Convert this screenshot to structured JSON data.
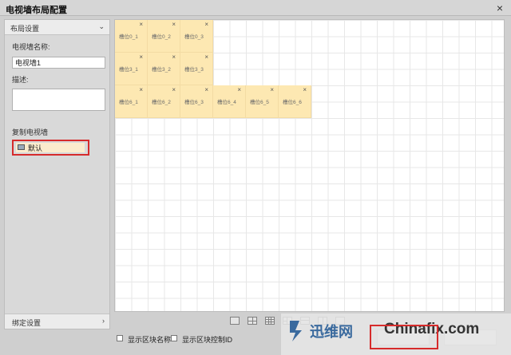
{
  "window": {
    "title": "电视墙布局配置",
    "close_glyph": "×"
  },
  "sidebar": {
    "section_title": "布局设置",
    "name_label": "电视墙名称:",
    "name_value": "电视墙1",
    "desc_label": "描述:",
    "desc_value": "",
    "copy_label": "复制电视墙",
    "copy_item": "默认",
    "binding_label": "绑定设置"
  },
  "grid": {
    "cells": [
      {
        "label": "槽位0_1"
      },
      {
        "label": "槽位0_2"
      },
      {
        "label": "槽位0_3"
      },
      {
        "label": "槽位3_1"
      },
      {
        "label": "槽位3_2"
      },
      {
        "label": "槽位3_3"
      },
      {
        "label": "槽位6_1"
      },
      {
        "label": "槽位6_2"
      },
      {
        "label": "槽位6_3"
      },
      {
        "label": "槽位6_4"
      },
      {
        "label": "槽位6_5"
      },
      {
        "label": "槽位6_6"
      }
    ],
    "cell_remove_glyph": "×",
    "layout_buttons": [
      "layout-1x1",
      "layout-2x2",
      "layout-3x3",
      "layout-4x4",
      "layout-custom-1",
      "layout-custom-2",
      "layout-custom-3",
      "layout-clear"
    ]
  },
  "options": {
    "show_block_name": "显示区块名称",
    "show_block_control_id": "显示区块控制ID"
  },
  "watermark": {
    "cn": "迅维网",
    "en": "Chinafix.com"
  },
  "colors": {
    "cell": "#fde8b2",
    "highlight": "#d62b2b",
    "brand": "#3a6a9e"
  }
}
